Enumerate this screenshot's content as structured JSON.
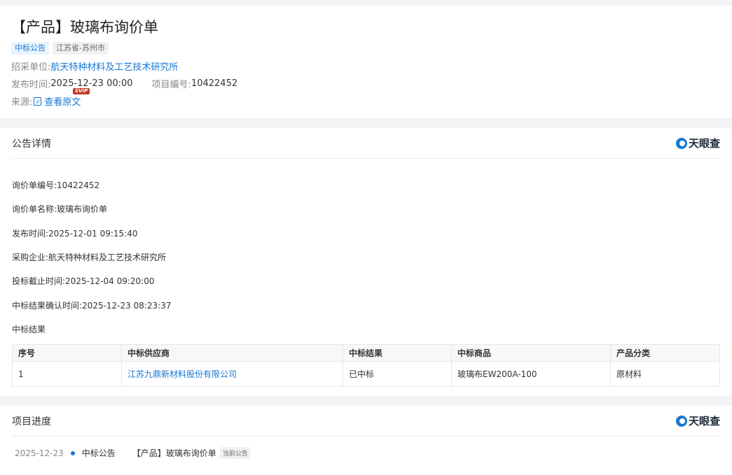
{
  "header": {
    "title": "【产品】玻璃布询价单",
    "tags": [
      "中标公告",
      "江苏省-苏州市"
    ],
    "buyer_label": "招采单位:",
    "buyer_value": "航天特种材料及工艺技术研究所",
    "pub_label": "发布时间:",
    "pub_value": "2025-12-23 00:00",
    "proj_label": "项目编号:",
    "proj_value": "10422452",
    "source_label": "来源:",
    "source_link": "查看原文",
    "svip": "SVIP"
  },
  "detail": {
    "section_title": "公告详情",
    "brand": "天眼查",
    "lines": [
      "询价单编号:10422452",
      "询价单名称:玻璃布询价单",
      "发布时间:2025-12-01 09:15:40",
      "采购企业:航天特种材料及工艺技术研究所",
      "投标截止时间:2025-12-04 09:20:00",
      "中标结果确认时间:2025-12-23 08:23:37",
      "中标结果"
    ],
    "table": {
      "headers": [
        "序号",
        "中标供应商",
        "中标结果",
        "中标商品",
        "产品分类"
      ],
      "rows": [
        [
          "1",
          "江苏九鼎新材料股份有限公司",
          "已中标",
          "玻璃布EW200A-100",
          "原材料"
        ]
      ]
    }
  },
  "progress": {
    "section_title": "项目进度",
    "brand": "天眼查",
    "item": {
      "date": "2025-12-23",
      "type": "中标公告",
      "title": "【产品】玻璃布询价单",
      "badge": "当前公告"
    }
  },
  "colors": {
    "accent": "#1677d3",
    "background": "#f2f3f5"
  }
}
